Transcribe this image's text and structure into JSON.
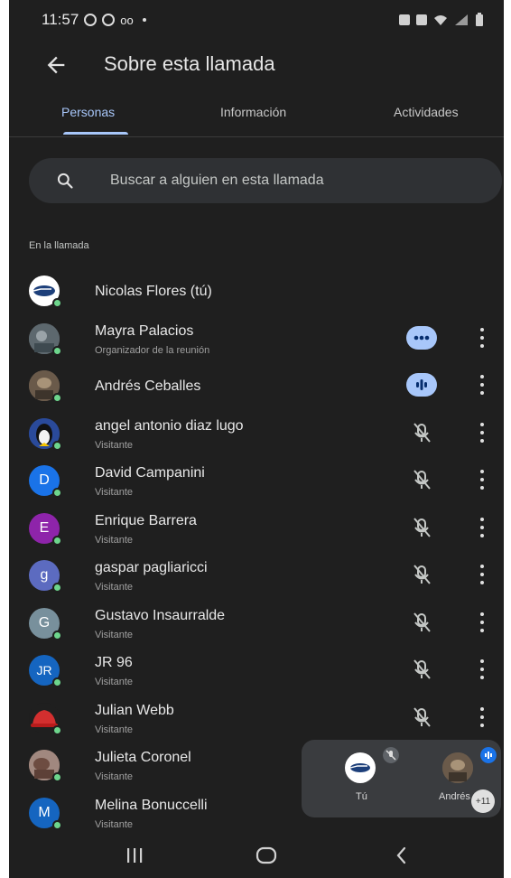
{
  "status_bar": {
    "time": "11:57",
    "notif_text": "oo"
  },
  "header": {
    "title": "Sobre esta llamada"
  },
  "tabs": [
    {
      "label": "Personas",
      "active": true
    },
    {
      "label": "Información",
      "active": false
    },
    {
      "label": "Actividades",
      "active": false
    }
  ],
  "search": {
    "placeholder": "Buscar a alguien en esta llamada"
  },
  "section_label": "En la llamada",
  "participants": [
    {
      "name": "Nicolas Flores (tú)",
      "role": "",
      "initial": "",
      "avatar_color": "#ffffff",
      "status": "none"
    },
    {
      "name": "Mayra Palacios",
      "role": "Organizador de la reunión",
      "initial": "",
      "avatar_color": "#6f7a80",
      "status": "more-active"
    },
    {
      "name": "Andrés Ceballes",
      "role": "",
      "initial": "",
      "avatar_color": "#7a6a5a",
      "status": "speaking"
    },
    {
      "name": "angel antonio diaz lugo",
      "role": "Visitante",
      "initial": "",
      "avatar_color": "#2a4a9a",
      "status": "muted"
    },
    {
      "name": "David Campanini",
      "role": "Visitante",
      "initial": "D",
      "avatar_color": "#1a73e8",
      "status": "muted"
    },
    {
      "name": "Enrique Barrera",
      "role": "Visitante",
      "initial": "E",
      "avatar_color": "#8e24aa",
      "status": "muted"
    },
    {
      "name": "gaspar pagliaricci",
      "role": "Visitante",
      "initial": "g",
      "avatar_color": "#5c6bc0",
      "status": "muted"
    },
    {
      "name": "Gustavo Insaurralde",
      "role": "Visitante",
      "initial": "G",
      "avatar_color": "#78909c",
      "status": "muted"
    },
    {
      "name": "JR 96",
      "role": "Visitante",
      "initial": "JR",
      "avatar_color": "#1565c0",
      "status": "muted"
    },
    {
      "name": "Julian Webb",
      "role": "Visitante",
      "initial": "",
      "avatar_color": "#c62828",
      "status": "muted"
    },
    {
      "name": "Julieta Coronel",
      "role": "Visitante",
      "initial": "",
      "avatar_color": "#8d6e63",
      "status": "none"
    },
    {
      "name": "Melina Bonuccelli",
      "role": "Visitante",
      "initial": "M",
      "avatar_color": "#1565c0",
      "status": "none"
    }
  ],
  "floating": {
    "self_label": "Tú",
    "other_label": "Andrés",
    "extra_count": "+11"
  },
  "colors": {
    "accent": "#a8c7fa",
    "background": "#1f1f1f",
    "online": "#6dd58c",
    "surface": "#2f3134"
  }
}
